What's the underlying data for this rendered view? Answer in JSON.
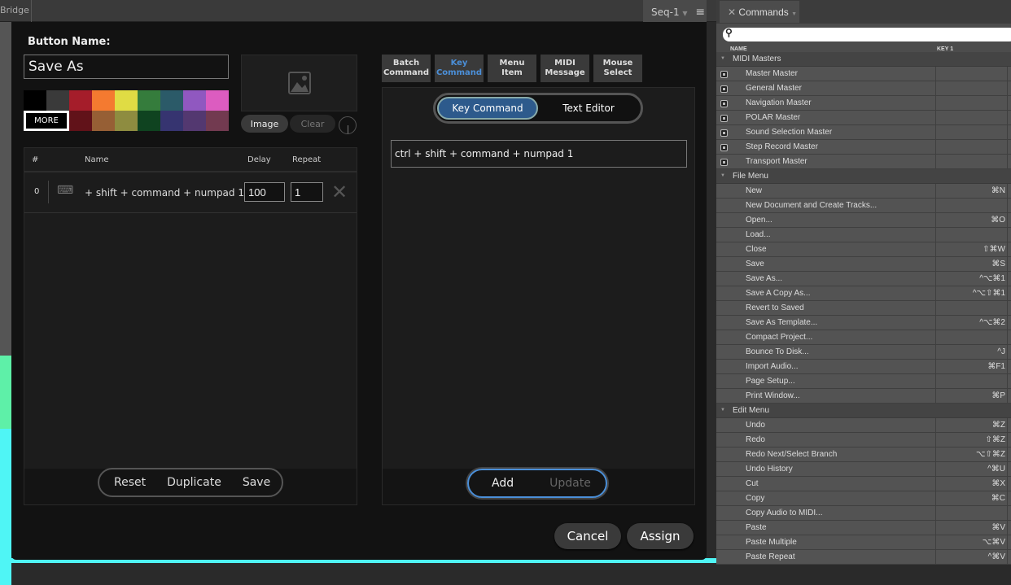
{
  "topbar": {
    "bridge": "Bridge",
    "seq_tab": "Seq-1"
  },
  "dialog": {
    "button_name_label": "Button Name:",
    "button_name_value": "Save As",
    "colors_top": [
      "#000000",
      "#3a3a3a",
      "#a51d2a",
      "#f47a30",
      "#e0dc44",
      "#357c3c",
      "#2b5a68",
      "#9058c0",
      "#dc5cc0"
    ],
    "colors_bottom": [
      "#611219",
      "#965f35",
      "#8e8c40",
      "#0f4320",
      "#363470",
      "#533870",
      "#723a50"
    ],
    "more_label": "MORE",
    "image_button": "Image",
    "clear_button": "Clear",
    "list": {
      "headers": {
        "num": "#",
        "name": "Name",
        "delay": "Delay",
        "repeat": "Repeat"
      },
      "rows": [
        {
          "num": "0",
          "name": "+ shift + command + numpad 1",
          "delay": "100",
          "repeat": "1"
        }
      ]
    },
    "list_buttons": {
      "reset": "Reset",
      "duplicate": "Duplicate",
      "save": "Save"
    },
    "tabs": [
      {
        "label": "Batch Command"
      },
      {
        "label": "Key Command",
        "active": true
      },
      {
        "label": "Menu Item"
      },
      {
        "label": "MIDI Message"
      },
      {
        "label": "Mouse Select"
      }
    ],
    "mode": {
      "key_command": "Key Command",
      "text_editor": "Text Editor",
      "selected": "Key Command"
    },
    "key_command_value": "ctrl + shift + command + numpad 1",
    "add": "Add",
    "update": "Update",
    "cancel": "Cancel",
    "assign": "Assign"
  },
  "commands": {
    "tab_title": "Commands",
    "search_placeholder": "",
    "col_name": "NAME",
    "col_key1": "KEY 1",
    "groups": [
      {
        "name": "MIDI Masters",
        "checkbox": true,
        "items": [
          {
            "name": "Master Master",
            "key": ""
          },
          {
            "name": "General Master",
            "key": ""
          },
          {
            "name": "Navigation Master",
            "key": ""
          },
          {
            "name": "POLAR Master",
            "key": ""
          },
          {
            "name": "Sound Selection Master",
            "key": ""
          },
          {
            "name": "Step Record Master",
            "key": ""
          },
          {
            "name": "Transport Master",
            "key": ""
          }
        ]
      },
      {
        "name": "File Menu",
        "items": [
          {
            "name": "New",
            "key": "⌘N"
          },
          {
            "name": "New Document and Create Tracks...",
            "key": ""
          },
          {
            "name": "Open...",
            "key": "⌘O"
          },
          {
            "name": "Load...",
            "key": ""
          },
          {
            "name": "Close",
            "key": "⇧⌘W"
          },
          {
            "name": "Save",
            "key": "⌘S"
          },
          {
            "name": "Save As...",
            "key": "^⌥⌘1"
          },
          {
            "name": "Save A Copy As...",
            "key": "^⌥⇧⌘1"
          },
          {
            "name": "Revert to Saved",
            "key": ""
          },
          {
            "name": "Save As Template...",
            "key": "^⌥⌘2"
          },
          {
            "name": "Compact Project...",
            "key": ""
          },
          {
            "name": "Bounce To Disk...",
            "key": "^J"
          },
          {
            "name": "Import Audio...",
            "key": "⌘F1"
          },
          {
            "name": "Page Setup...",
            "key": ""
          },
          {
            "name": "Print Window...",
            "key": "⌘P"
          }
        ]
      },
      {
        "name": "Edit Menu",
        "items": [
          {
            "name": "Undo",
            "key": "⌘Z"
          },
          {
            "name": "Redo",
            "key": "⇧⌘Z"
          },
          {
            "name": "Redo Next/Select Branch",
            "key": "⌥⇧⌘Z"
          },
          {
            "name": "Undo History",
            "key": "^⌘U"
          },
          {
            "name": "Cut",
            "key": "⌘X"
          },
          {
            "name": "Copy",
            "key": "⌘C"
          },
          {
            "name": "Copy Audio to MIDI...",
            "key": ""
          },
          {
            "name": "Paste",
            "key": "⌘V"
          },
          {
            "name": "Paste Multiple",
            "key": "⌥⌘V"
          },
          {
            "name": "Paste Repeat",
            "key": "^⌘V"
          }
        ]
      }
    ]
  }
}
